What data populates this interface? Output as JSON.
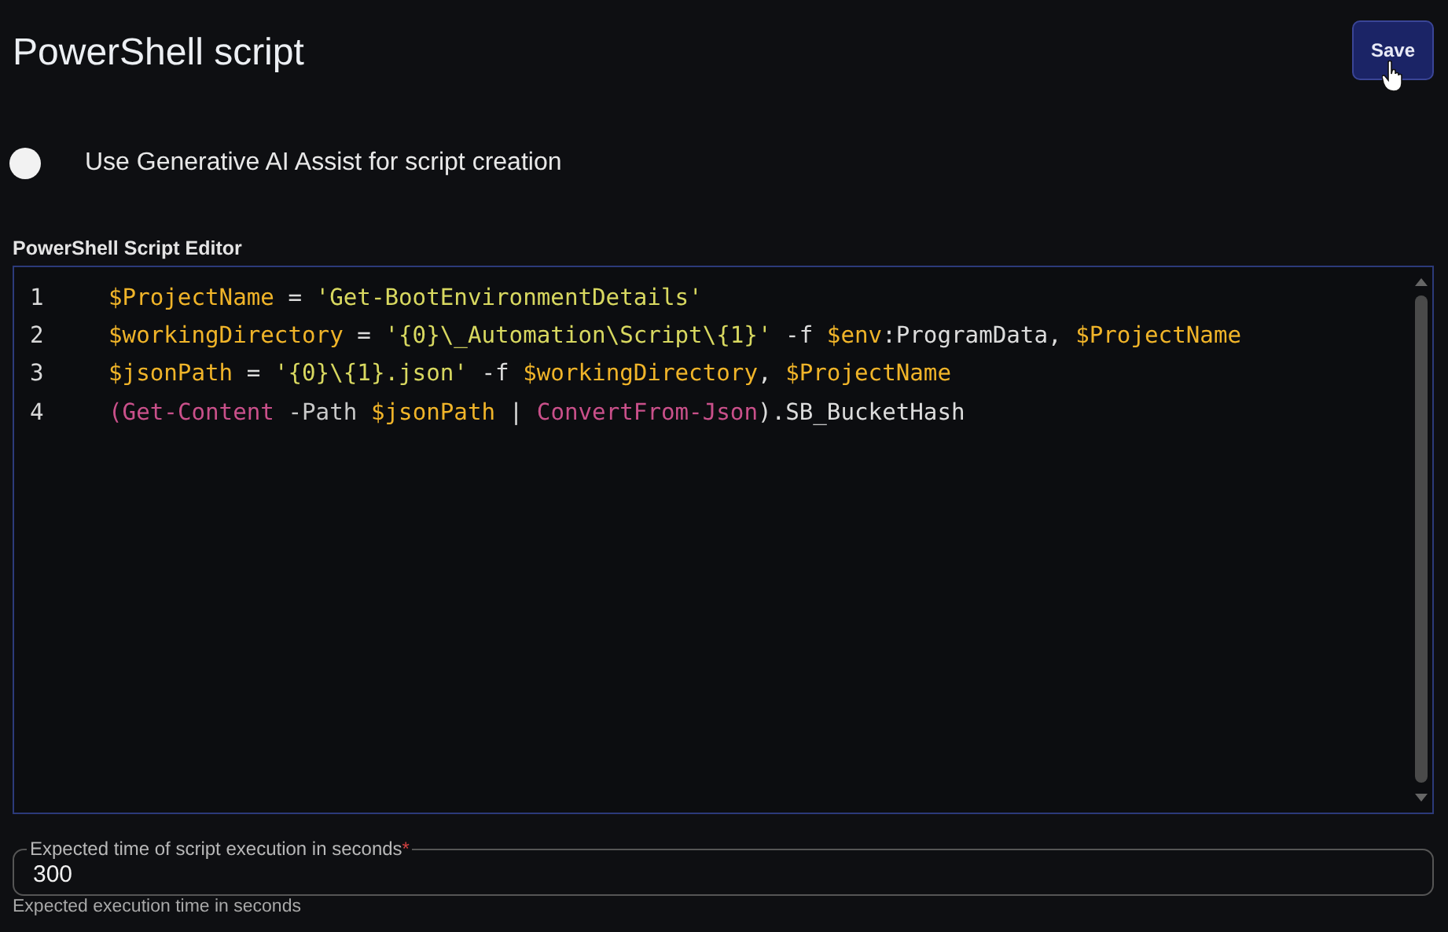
{
  "title": "PowerShell script",
  "save_button": {
    "label": "Save"
  },
  "ai_assist": {
    "label": "Use Generative AI Assist for script creation",
    "on": false
  },
  "editor": {
    "label": "PowerShell Script Editor",
    "lines": [
      {
        "number": "1",
        "tokens": [
          {
            "kind": "variable",
            "text": "$ProjectName"
          },
          {
            "kind": "plain",
            "text": " = "
          },
          {
            "kind": "string",
            "text": "'Get-BootEnvironmentDetails'"
          }
        ]
      },
      {
        "number": "2",
        "tokens": [
          {
            "kind": "variable",
            "text": "$workingDirectory"
          },
          {
            "kind": "plain",
            "text": " = "
          },
          {
            "kind": "string",
            "text": "'{0}\\_Automation\\Script\\{1}'"
          },
          {
            "kind": "plain",
            "text": " -f "
          },
          {
            "kind": "variable",
            "text": "$env"
          },
          {
            "kind": "plain",
            "text": ":ProgramData, "
          },
          {
            "kind": "variable",
            "text": "$ProjectName"
          }
        ]
      },
      {
        "number": "3",
        "tokens": [
          {
            "kind": "variable",
            "text": "$jsonPath"
          },
          {
            "kind": "plain",
            "text": " = "
          },
          {
            "kind": "string",
            "text": "'{0}\\{1}.json'"
          },
          {
            "kind": "plain",
            "text": " -f "
          },
          {
            "kind": "variable",
            "text": "$workingDirectory"
          },
          {
            "kind": "plain",
            "text": ", "
          },
          {
            "kind": "variable",
            "text": "$ProjectName"
          }
        ]
      },
      {
        "number": "4",
        "tokens": [
          {
            "kind": "cmdlet",
            "text": "("
          },
          {
            "kind": "cmdlet",
            "text": "Get-Content"
          },
          {
            "kind": "parameter",
            "text": " -Path "
          },
          {
            "kind": "variable",
            "text": "$jsonPath"
          },
          {
            "kind": "plain",
            "text": " | "
          },
          {
            "kind": "cmdlet",
            "text": "ConvertFrom-Json"
          },
          {
            "kind": "plain",
            "text": ").SB_BucketHash"
          }
        ]
      }
    ]
  },
  "execution_time": {
    "label": "Expected time of script execution in seconds",
    "required": true,
    "required_mark": "*",
    "value": "300",
    "helper": "Expected execution time in seconds"
  }
}
